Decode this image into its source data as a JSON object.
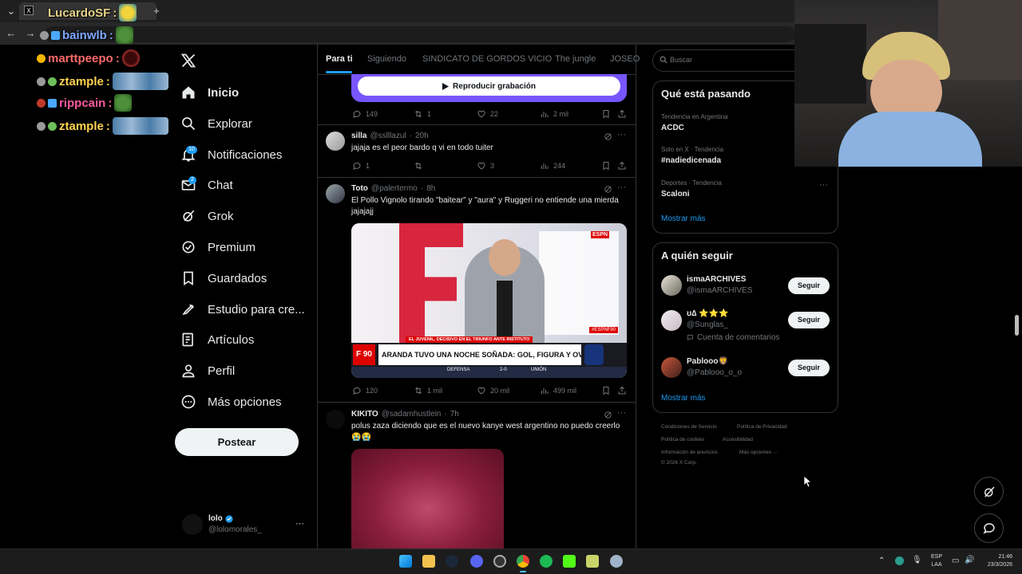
{
  "chat": [
    {
      "user": "LucardoSF",
      "color": "#e8d48a"
    },
    {
      "user": "bainwlb",
      "color": "#7fa8ff"
    },
    {
      "user": "marttpeepo",
      "color": "#ff6a6a"
    },
    {
      "user": "ztample",
      "color": "#ffd34d"
    },
    {
      "user": "rippcain",
      "color": "#ff5a9a"
    },
    {
      "user": "ztample",
      "color": "#ffd34d"
    }
  ],
  "nav": {
    "items": [
      "Inicio",
      "Explorar",
      "Notificaciones",
      "Chat",
      "Grok",
      "Premium",
      "Guardados",
      "Estudio para cre...",
      "Artículos",
      "Perfil",
      "Más opciones"
    ],
    "notif_count": "10",
    "chat_count": "2",
    "post_label": "Postear",
    "profile_name": "lolo",
    "profile_handle": "@lolomorales_",
    "profile_more": "···"
  },
  "timeline": {
    "tabs": [
      "Para ti",
      "Siguiendo",
      "SINDICATO DE GORDOS VICIO",
      "The jungle",
      "JOSEO"
    ],
    "top_tweet": {
      "button": "Reproducir grabación",
      "replies": "149",
      "retweets": "1",
      "likes": "22",
      "views": "2 mil"
    },
    "tweets": [
      {
        "name": "silla",
        "handle": "@sslllazul",
        "time": "20h",
        "text": "jajaja es el peor bardo q vi en todo tuiter",
        "replies": "1",
        "retweets": "",
        "likes": "3",
        "views": "244"
      },
      {
        "name": "Toto",
        "handle": "@palertermo",
        "time": "8h",
        "text_line1": "El Pollo Vignolo tirando \"baitear\" y \"aura\" y Ruggeri no entiende una mierda",
        "text_line2": "jajajajj",
        "replies": "120",
        "retweets": "1 mil",
        "likes": "20 mil",
        "views": "499 mil",
        "media": {
          "channel": "ESPN",
          "caption_small": "EL JUVENIL, DECISIVO EN EL TRIUNFO ANTE INSTITUTO",
          "show": "F 90",
          "headline": "ARANDA TUVO UNA NOCHE SOÑADA: GOL, FIGURA Y OVACIÓN",
          "tag": "#ESPNF90",
          "bar_left": "DEFENSA",
          "bar_score": "2-0",
          "bar_right": "UNIÓN"
        }
      },
      {
        "name": "KIKITO",
        "handle": "@sadamhustlein",
        "time": "7h",
        "text": "polus zaza diciendo que es el nuevo kanye west argentino no puedo creerlo",
        "emoji": "😭😭"
      }
    ]
  },
  "right": {
    "search_placeholder": "Buscar",
    "trends_title": "Qué está pasando",
    "trends": [
      {
        "context": "Tendencia en Argentina",
        "name": "ACDC"
      },
      {
        "context": "Solo en X · Tendencia",
        "name": "#nadiedicenada"
      },
      {
        "context": "Deportes · Tendencia",
        "name": "Scaloni"
      }
    ],
    "show_more": "Mostrar más",
    "follow_title": "A quién seguir",
    "follow": [
      {
        "name": "ismaARCHIVES",
        "handle": "@ismaARCHIVES",
        "extra": ""
      },
      {
        "name": "ʊ∆ ⭐⭐⭐",
        "handle": "@Sunglas_",
        "extra": "Cuenta de comentarios"
      },
      {
        "name": "Pablooo🦁",
        "handle": "@Pablooo_o_o",
        "extra": ""
      }
    ],
    "follow_button": "Seguir",
    "footer": [
      "Condiciones de Servicio",
      "Política de Privacidad",
      "Política de cookies",
      "Accesibilidad",
      "Información de anuncios",
      "Más opciones ···",
      "© 2026 X Corp."
    ]
  },
  "taskbar": {
    "lang1": "ESP",
    "lang2": "LAA",
    "time": "21:46",
    "date": "23/3/2026"
  }
}
